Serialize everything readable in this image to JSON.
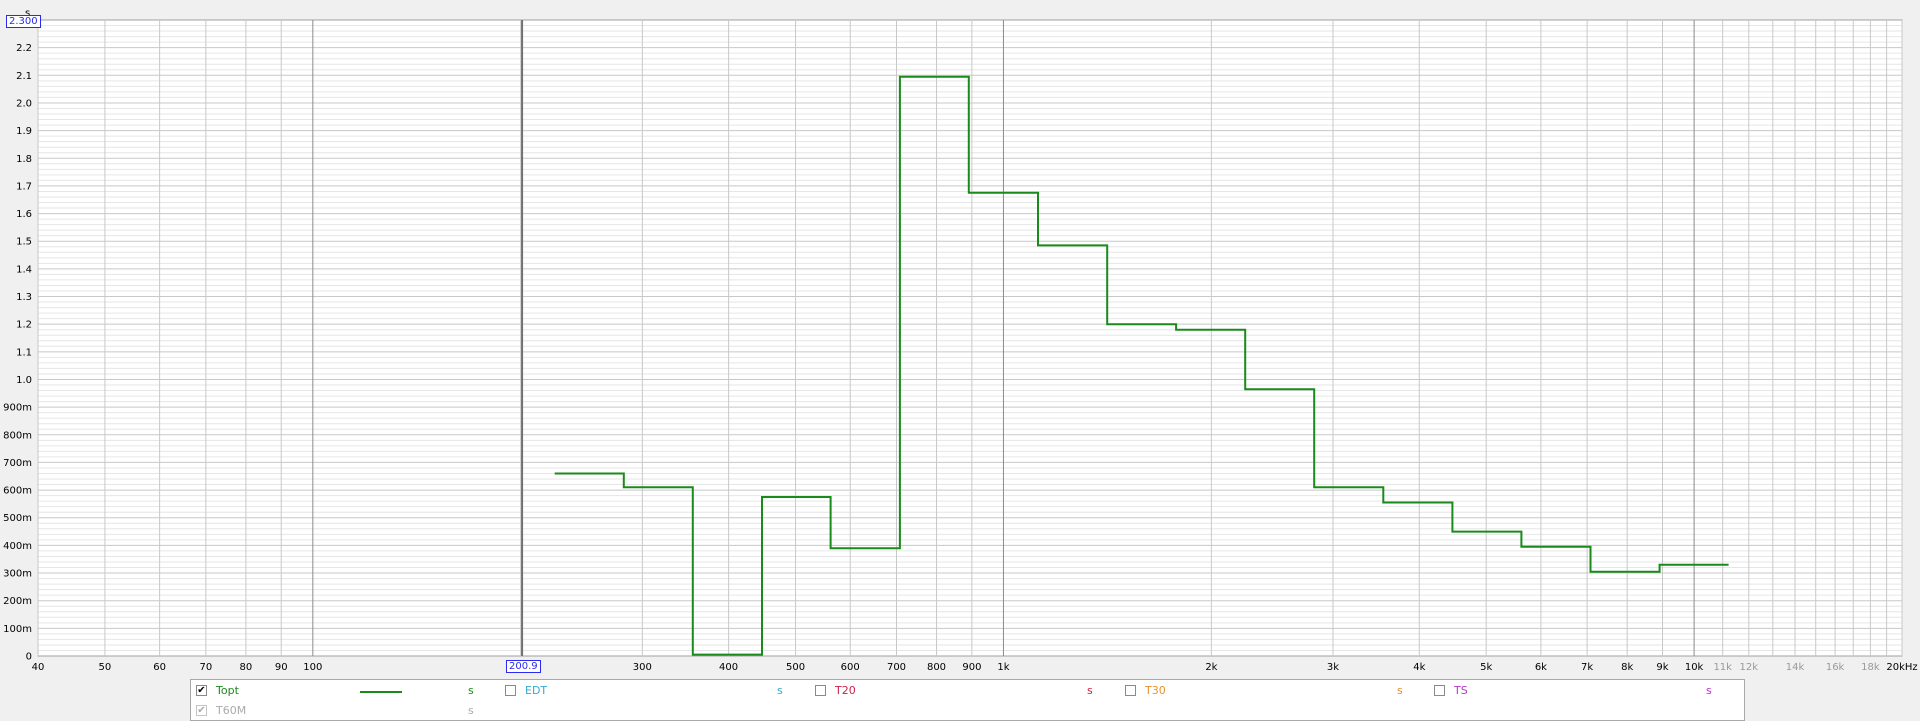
{
  "colors": {
    "background": "#f0f0f0",
    "plot_bg": "#ffffff",
    "grid_minor": "#e6e6e6",
    "grid_major": "#c8c8c8",
    "grid_decade": "#8c8c8c",
    "trace": "#1a8a1a",
    "marker": "#2a2af0"
  },
  "cursor": {
    "y_readout": "2.300",
    "x_readout": "200.9"
  },
  "chart_data": {
    "type": "line",
    "x_scale": "log",
    "xlim": [
      40,
      20000
    ],
    "ylim": [
      0,
      2.3
    ],
    "grid": true,
    "y_unit_label": "s",
    "x_ticks": [
      {
        "v": 40,
        "label": "40",
        "dim": false
      },
      {
        "v": 50,
        "label": "50",
        "dim": false
      },
      {
        "v": 60,
        "label": "60",
        "dim": false
      },
      {
        "v": 70,
        "label": "70",
        "dim": false
      },
      {
        "v": 80,
        "label": "80",
        "dim": false
      },
      {
        "v": 90,
        "label": "90",
        "dim": false
      },
      {
        "v": 100,
        "label": "100",
        "dim": false
      },
      {
        "v": 300,
        "label": "300",
        "dim": false
      },
      {
        "v": 400,
        "label": "400",
        "dim": false
      },
      {
        "v": 500,
        "label": "500",
        "dim": false
      },
      {
        "v": 600,
        "label": "600",
        "dim": false
      },
      {
        "v": 700,
        "label": "700",
        "dim": false
      },
      {
        "v": 800,
        "label": "800",
        "dim": false
      },
      {
        "v": 900,
        "label": "900",
        "dim": false
      },
      {
        "v": 1000,
        "label": "1k",
        "dim": false
      },
      {
        "v": 2000,
        "label": "2k",
        "dim": false
      },
      {
        "v": 3000,
        "label": "3k",
        "dim": false
      },
      {
        "v": 4000,
        "label": "4k",
        "dim": false
      },
      {
        "v": 5000,
        "label": "5k",
        "dim": false
      },
      {
        "v": 6000,
        "label": "6k",
        "dim": false
      },
      {
        "v": 7000,
        "label": "7k",
        "dim": false
      },
      {
        "v": 8000,
        "label": "8k",
        "dim": false
      },
      {
        "v": 9000,
        "label": "9k",
        "dim": false
      },
      {
        "v": 10000,
        "label": "10k",
        "dim": false
      },
      {
        "v": 11000,
        "label": "11k",
        "dim": true
      },
      {
        "v": 12000,
        "label": "12k",
        "dim": true
      },
      {
        "v": 14000,
        "label": "14k",
        "dim": true
      },
      {
        "v": 16000,
        "label": "16k",
        "dim": true
      },
      {
        "v": 18000,
        "label": "18k",
        "dim": true
      },
      {
        "v": 20000,
        "label": "20kHz",
        "dim": false
      }
    ],
    "y_ticks": [
      {
        "v": 0,
        "label": "0"
      },
      {
        "v": 0.1,
        "label": "100m"
      },
      {
        "v": 0.2,
        "label": "200m"
      },
      {
        "v": 0.3,
        "label": "300m"
      },
      {
        "v": 0.4,
        "label": "400m"
      },
      {
        "v": 0.5,
        "label": "500m"
      },
      {
        "v": 0.6,
        "label": "600m"
      },
      {
        "v": 0.7,
        "label": "700m"
      },
      {
        "v": 0.8,
        "label": "800m"
      },
      {
        "v": 0.9,
        "label": "900m"
      },
      {
        "v": 1.0,
        "label": "1.0"
      },
      {
        "v": 1.1,
        "label": "1.1"
      },
      {
        "v": 1.2,
        "label": "1.2"
      },
      {
        "v": 1.3,
        "label": "1.3"
      },
      {
        "v": 1.4,
        "label": "1.4"
      },
      {
        "v": 1.5,
        "label": "1.5"
      },
      {
        "v": 1.6,
        "label": "1.6"
      },
      {
        "v": 1.7,
        "label": "1.7"
      },
      {
        "v": 1.8,
        "label": "1.8"
      },
      {
        "v": 1.9,
        "label": "1.9"
      },
      {
        "v": 2.0,
        "label": "2.0"
      },
      {
        "v": 2.1,
        "label": "2.1"
      },
      {
        "v": 2.2,
        "label": "2.2"
      }
    ],
    "series": [
      {
        "name": "Topt",
        "color": "#1a8a1a",
        "step_bands": [
          {
            "f0": 224,
            "f1": 282,
            "y": 0.66
          },
          {
            "f0": 282,
            "f1": 355,
            "y": 0.61
          },
          {
            "f0": 355,
            "f1": 447,
            "y": 0.005
          },
          {
            "f0": 447,
            "f1": 562,
            "y": 0.575
          },
          {
            "f0": 562,
            "f1": 708,
            "y": 0.39
          },
          {
            "f0": 708,
            "f1": 891,
            "y": 2.095
          },
          {
            "f0": 891,
            "f1": 1122,
            "y": 1.675
          },
          {
            "f0": 1122,
            "f1": 1413,
            "y": 1.485
          },
          {
            "f0": 1413,
            "f1": 1778,
            "y": 1.2
          },
          {
            "f0": 1778,
            "f1": 2239,
            "y": 1.18
          },
          {
            "f0": 2239,
            "f1": 2818,
            "y": 0.965
          },
          {
            "f0": 2818,
            "f1": 3548,
            "y": 0.61
          },
          {
            "f0": 3548,
            "f1": 4467,
            "y": 0.555
          },
          {
            "f0": 4467,
            "f1": 5623,
            "y": 0.45
          },
          {
            "f0": 5623,
            "f1": 7079,
            "y": 0.395
          },
          {
            "f0": 7079,
            "f1": 8913,
            "y": 0.305
          },
          {
            "f0": 8913,
            "f1": 11220,
            "y": 0.33
          }
        ]
      }
    ]
  },
  "legend": {
    "items": [
      {
        "label": "Topt",
        "unit": "s",
        "checked": true,
        "disabled": false,
        "color": "#1a8a1a",
        "show_swatch": true
      },
      {
        "label": "EDT",
        "unit": "s",
        "checked": false,
        "disabled": false,
        "color": "#33aacc",
        "show_swatch": false
      },
      {
        "label": "T20",
        "unit": "s",
        "checked": false,
        "disabled": false,
        "color": "#cc2244",
        "show_swatch": false
      },
      {
        "label": "T30",
        "unit": "s",
        "checked": false,
        "disabled": false,
        "color": "#e8902a",
        "show_swatch": false
      },
      {
        "label": "TS",
        "unit": "s",
        "checked": false,
        "disabled": false,
        "color": "#bb33cc",
        "show_swatch": false
      },
      {
        "label": "T60M",
        "unit": "s",
        "checked": true,
        "disabled": true,
        "color": "#aaaaaa",
        "show_swatch": false
      }
    ]
  }
}
